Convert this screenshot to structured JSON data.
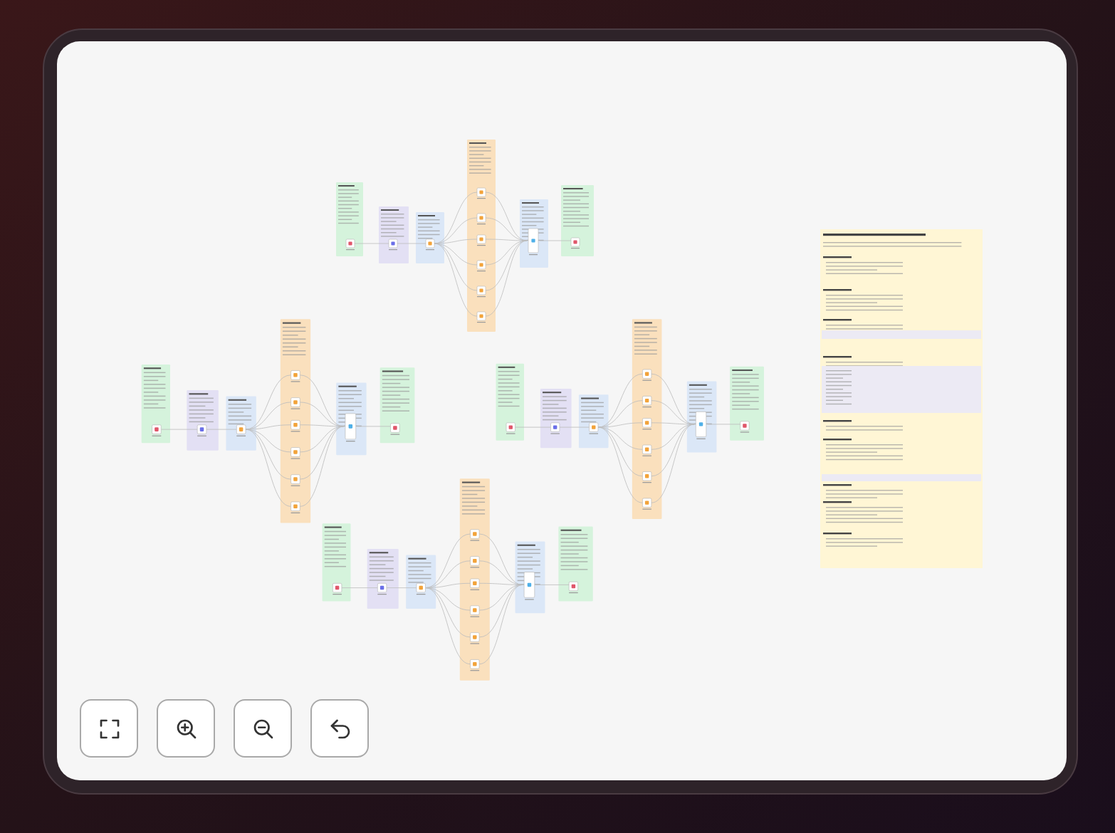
{
  "canvas": {
    "workflows": [
      {
        "notes": [
          {
            "color": "#d5f3dc"
          },
          {
            "color": "#e3e0f4"
          },
          {
            "color": "#dbe7f7"
          },
          {
            "color": "#fae0bd"
          },
          {
            "color": "#dbe7f7"
          },
          {
            "color": "#d5f3dc"
          }
        ]
      },
      {
        "notes": [
          {
            "color": "#d5f3dc"
          },
          {
            "color": "#e3e0f4"
          },
          {
            "color": "#dbe7f7"
          },
          {
            "color": "#fae0bd"
          },
          {
            "color": "#dbe7f7"
          },
          {
            "color": "#d5f3dc"
          }
        ]
      },
      {
        "notes": [
          {
            "color": "#d5f3dc"
          },
          {
            "color": "#e3e0f4"
          },
          {
            "color": "#dbe7f7"
          },
          {
            "color": "#fae0bd"
          },
          {
            "color": "#dbe7f7"
          },
          {
            "color": "#d5f3dc"
          }
        ]
      },
      {
        "notes": [
          {
            "color": "#d5f3dc"
          },
          {
            "color": "#e3e0f4"
          },
          {
            "color": "#dbe7f7"
          },
          {
            "color": "#fae0bd"
          },
          {
            "color": "#dbe7f7"
          },
          {
            "color": "#d5f3dc"
          }
        ]
      }
    ],
    "documentation_notes": [
      {
        "color": "#fff6d5"
      }
    ]
  },
  "controls": [
    {
      "kind": "fit"
    },
    {
      "kind": "zoom_in"
    },
    {
      "kind": "zoom_out"
    },
    {
      "kind": "undo"
    }
  ]
}
